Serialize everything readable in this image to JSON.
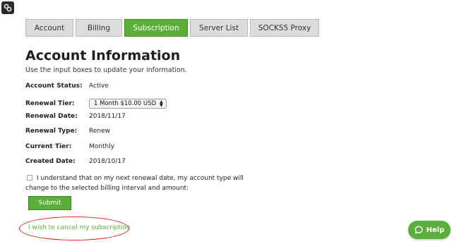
{
  "tabs": [
    {
      "label": "Account"
    },
    {
      "label": "Billing"
    },
    {
      "label": "Subscription"
    },
    {
      "label": "Server List"
    },
    {
      "label": "SOCKS5 Proxy"
    }
  ],
  "active_tab": "Subscription",
  "page": {
    "title": "Account Information",
    "subtitle": "Use the input boxes to update your information."
  },
  "fields": {
    "status": {
      "label": "Account Status:",
      "value": "Active"
    },
    "renewal_tier": {
      "label": "Renewal Tier:",
      "value": "1 Month $10.00 USD"
    },
    "renewal_date": {
      "label": "Renewal Date:",
      "value": "2018/11/17"
    },
    "renewal_type": {
      "label": "Renewal Type:",
      "value": "Renew"
    },
    "current_tier": {
      "label": "Current Tier:",
      "value": "Monthly"
    },
    "created_date": {
      "label": "Created Date:",
      "value": "2018/10/17"
    }
  },
  "agreement": {
    "text": "I understand that on my next renewal date, my account type will change to the selected billing interval and amount:",
    "checked": false
  },
  "submit_label": "Submit",
  "cancel_link": "I wish to cancel my subscription",
  "help_label": "Help",
  "colors": {
    "accent": "#5aaf3a",
    "annotation": "#e0201c",
    "tab_bg": "#dcdcdc"
  }
}
